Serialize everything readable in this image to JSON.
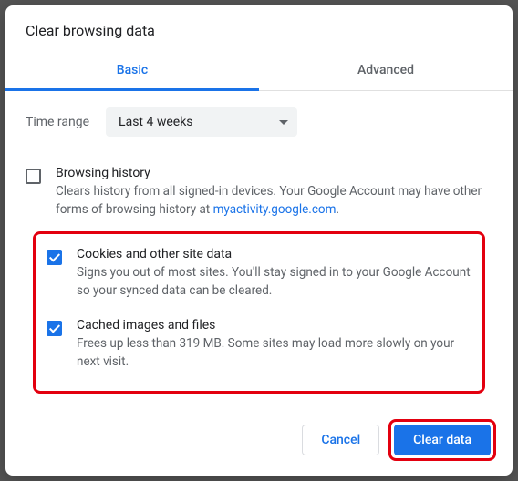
{
  "dialog": {
    "title": "Clear browsing data"
  },
  "tabs": {
    "basic": "Basic",
    "advanced": "Advanced",
    "active": 0
  },
  "time": {
    "label": "Time range",
    "value": "Last 4 weeks"
  },
  "options": {
    "history": {
      "title": "Browsing history",
      "desc_pre": "Clears history from all signed-in devices. Your Google Account may have other forms of browsing history at ",
      "link": "myactivity.google.com",
      "desc_post": ".",
      "checked": false
    },
    "cookies": {
      "title": "Cookies and other site data",
      "desc": "Signs you out of most sites. You'll stay signed in to your Google Account so your synced data can be cleared.",
      "checked": true
    },
    "cache": {
      "title": "Cached images and files",
      "desc": "Frees up less than 319 MB. Some sites may load more slowly on your next visit.",
      "checked": true
    }
  },
  "footer": {
    "cancel": "Cancel",
    "confirm": "Clear data"
  },
  "colors": {
    "accent": "#1a73e8",
    "highlight": "#e3000f"
  }
}
